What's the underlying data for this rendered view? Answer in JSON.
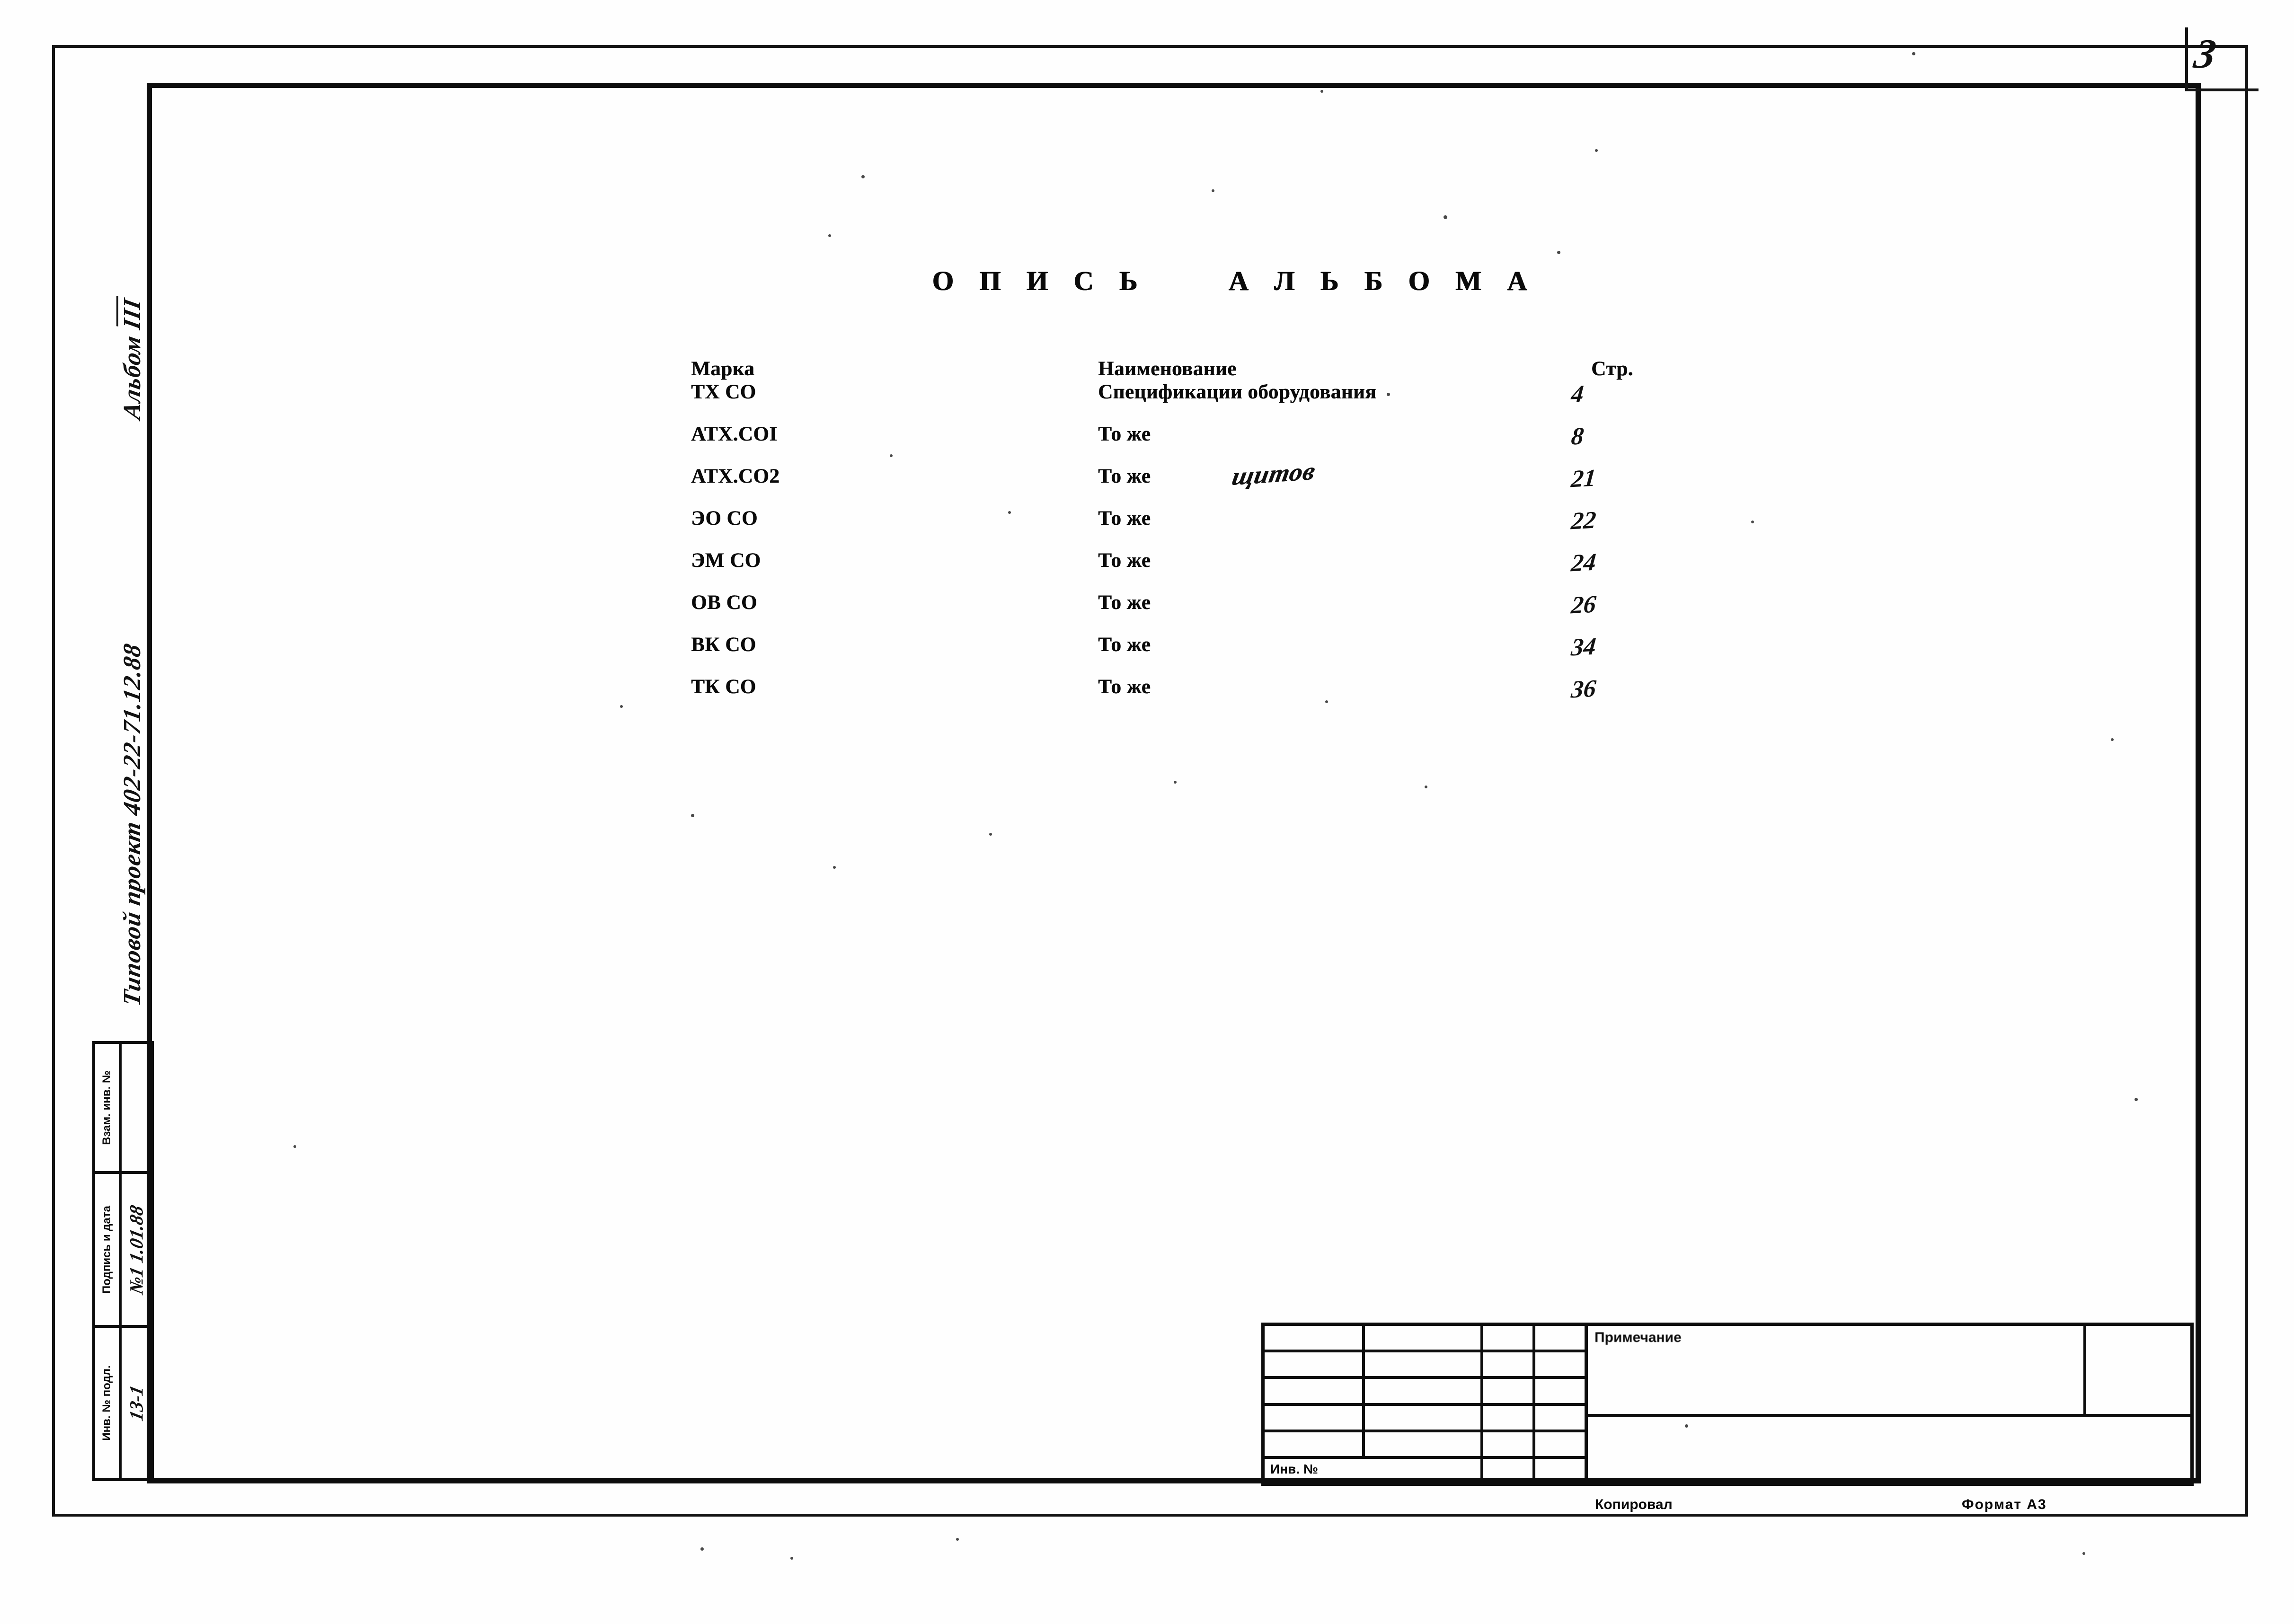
{
  "page": {
    "corner_number": "3",
    "format_label": "Формат А3",
    "copier_label": "Копировал"
  },
  "listing": {
    "title": "О П И С Ь     А Л Ь Б О М А",
    "headers": {
      "mark": "Марка",
      "name": "Наименование",
      "page": "Стр."
    },
    "rows": [
      {
        "mark": "ТХ СО",
        "name": "Спецификации оборудования",
        "note": "",
        "page": "4"
      },
      {
        "mark": "АТХ.СОI",
        "name": "То же",
        "note": "",
        "page": "8"
      },
      {
        "mark": "АТХ.СО2",
        "name": "То же",
        "note": "щитов",
        "page": "21"
      },
      {
        "mark": "ЭО СО",
        "name": "То же",
        "note": "",
        "page": "22"
      },
      {
        "mark": "ЭМ СО",
        "name": "То же",
        "note": "",
        "page": "24"
      },
      {
        "mark": "ОВ СО",
        "name": "То же",
        "note": "",
        "page": "26"
      },
      {
        "mark": "ВК СО",
        "name": "То же",
        "note": "",
        "page": "34"
      },
      {
        "mark": "ТК СО",
        "name": "То же",
        "note": "",
        "page": "36"
      }
    ]
  },
  "side_annotations": {
    "project": "Типовой проект 402-22-71.12.88",
    "album_prefix": "Альбом ",
    "album_number": "III"
  },
  "stamp_column": {
    "replaced_inv_label": "Взам. инв. №",
    "replaced_inv_value": "",
    "signature_date_label": "Подпись и дата",
    "signature_date_value": "№1 1.01.88",
    "inventory_label": "Инв. № подл.",
    "inventory_value": "13-1"
  },
  "title_block": {
    "inventory_label": "Инв. №",
    "note_label": "Примечание"
  }
}
